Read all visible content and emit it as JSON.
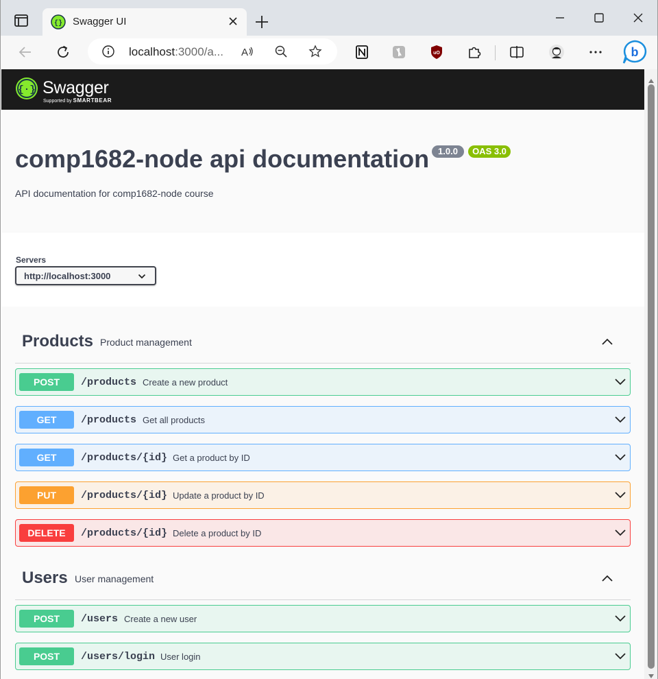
{
  "browser": {
    "tab_title": "Swagger UI",
    "url_host": "localhost",
    "url_rest": ":3000/a..."
  },
  "header": {
    "logo_name": "Swagger",
    "logo_supported": "Supported by",
    "logo_brand": "SMARTBEAR"
  },
  "info": {
    "title": "comp1682-node api documentation",
    "version": "1.0.0",
    "oas": "OAS 3.0",
    "description": "API documentation for comp1682-node course"
  },
  "servers": {
    "label": "Servers",
    "selected": "http://localhost:3000"
  },
  "tags": [
    {
      "name": "Products",
      "description": "Product management",
      "operations": [
        {
          "method": "POST",
          "path": "/products",
          "summary": "Create a new product"
        },
        {
          "method": "GET",
          "path": "/products",
          "summary": "Get all products"
        },
        {
          "method": "GET",
          "path": "/products/{id}",
          "summary": "Get a product by ID"
        },
        {
          "method": "PUT",
          "path": "/products/{id}",
          "summary": "Update a product by ID"
        },
        {
          "method": "DELETE",
          "path": "/products/{id}",
          "summary": "Delete a product by ID"
        }
      ]
    },
    {
      "name": "Users",
      "description": "User management",
      "operations": [
        {
          "method": "POST",
          "path": "/users",
          "summary": "Create a new user"
        },
        {
          "method": "POST",
          "path": "/users/login",
          "summary": "User login"
        }
      ]
    }
  ],
  "colors": {
    "post": "#49cc90",
    "get": "#61affe",
    "put": "#fca130",
    "delete": "#f93e3e",
    "swagger_green": "#85ea2d"
  }
}
